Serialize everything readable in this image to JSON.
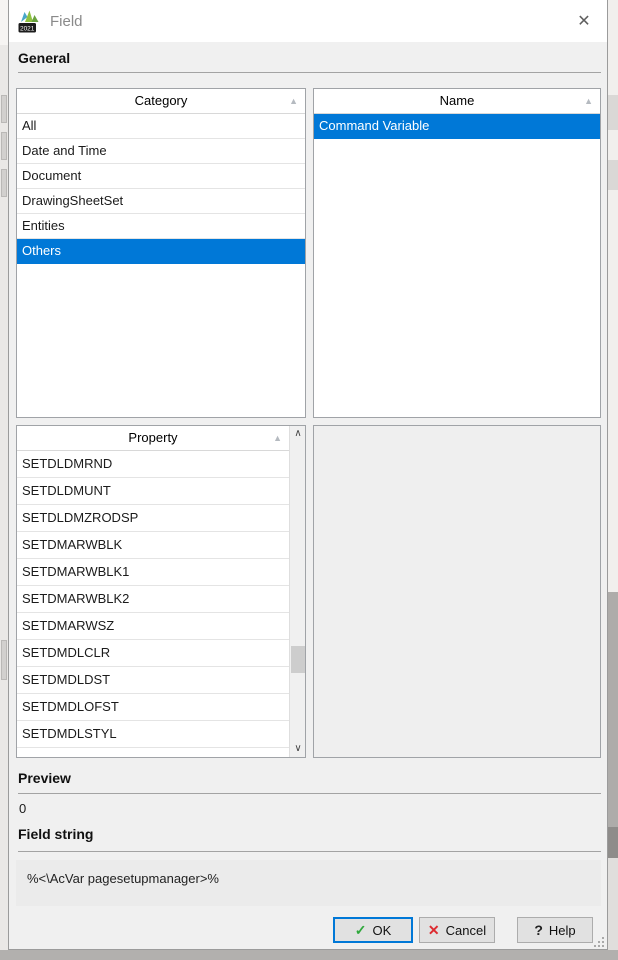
{
  "dialog": {
    "title": "Field",
    "app_icon_text": "2021"
  },
  "icons": {
    "close": "✕",
    "sort_asc": "▲",
    "scroll_up": "∧",
    "scroll_down": "∨",
    "ok_check": "✓",
    "cancel_x": "✕",
    "help_q": "?"
  },
  "sections": {
    "general": "General",
    "preview": "Preview",
    "field_string": "Field string"
  },
  "category_list": {
    "header": "Category",
    "items": [
      "All",
      "Date and Time",
      "Document",
      "DrawingSheetSet",
      "Entities",
      "Others"
    ],
    "selected": "Others"
  },
  "name_list": {
    "header": "Name",
    "items": [
      "Command Variable"
    ],
    "selected": "Command Variable"
  },
  "property_list": {
    "header": "Property",
    "items": [
      "SETDLDMRND",
      "SETDLDMUNT",
      "SETDLDMZRODSP",
      "SETDMARWBLK",
      "SETDMARWBLK1",
      "SETDMARWBLK2",
      "SETDMARWSZ",
      "SETDMDLCLR",
      "SETDMDLDST",
      "SETDMDLOFST",
      "SETDMDLSTYL"
    ]
  },
  "preview": {
    "value": "0"
  },
  "field_string": {
    "value": "%<\\AcVar pagesetupmanager>%"
  },
  "buttons": {
    "ok": "OK",
    "cancel": "Cancel",
    "help": "Help"
  },
  "colors": {
    "selection": "#0078d7",
    "ok_border": "#0078d7",
    "check_green": "#2fa83c",
    "cancel_red": "#dd2b30"
  }
}
